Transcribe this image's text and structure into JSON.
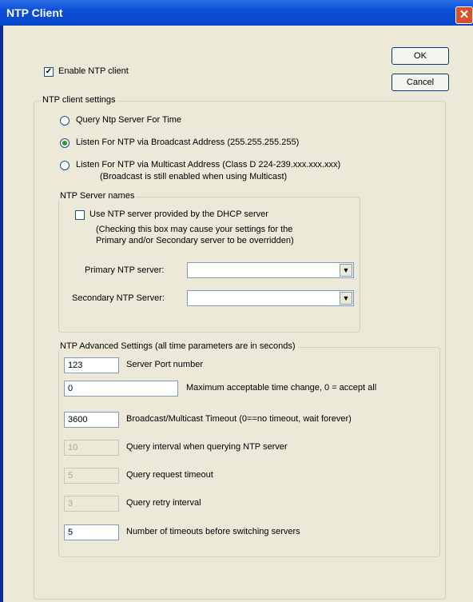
{
  "window": {
    "title": "NTP Client"
  },
  "buttons": {
    "ok": "OK",
    "cancel": "Cancel"
  },
  "enable": {
    "label": "Enable NTP client",
    "checked": true
  },
  "client_settings": {
    "legend": "NTP client settings",
    "options": [
      {
        "label": "Query Ntp Server For Time",
        "selected": false
      },
      {
        "label": "Listen For NTP via Broadcast Address (255.255.255.255)",
        "selected": true
      },
      {
        "label": "Listen For NTP via Multicast Address (Class D 224-239.xxx.xxx.xxx)",
        "note": "(Broadcast is still enabled when using Multicast)",
        "selected": false
      }
    ]
  },
  "server_names": {
    "legend": "NTP Server names",
    "dhcp_label": "Use NTP server provided by the DHCP server",
    "dhcp_note_1": "(Checking this box may cause your settings for the",
    "dhcp_note_2": "Primary and/or Secondary server to be overridden)",
    "dhcp_checked": false,
    "primary_label": "Primary NTP server:",
    "primary_value": "",
    "secondary_label": "Secondary NTP Server:",
    "secondary_value": ""
  },
  "advanced": {
    "legend": "NTP Advanced Settings (all time parameters are in seconds)",
    "rows": [
      {
        "value": "123",
        "label": "Server Port number",
        "enabled": true
      },
      {
        "value": "0",
        "label": "Maximum acceptable time change, 0 = accept all",
        "enabled": true
      },
      {
        "value": "3600",
        "label": "Broadcast/Multicast Timeout (0==no timeout, wait forever)",
        "enabled": true
      },
      {
        "value": "10",
        "label": "Query interval when querying NTP server",
        "enabled": false
      },
      {
        "value": "5",
        "label": "Query request timeout",
        "enabled": false
      },
      {
        "value": "3",
        "label": "Query retry interval",
        "enabled": false
      },
      {
        "value": "5",
        "label": "Number of timeouts before switching servers",
        "enabled": true
      }
    ]
  }
}
